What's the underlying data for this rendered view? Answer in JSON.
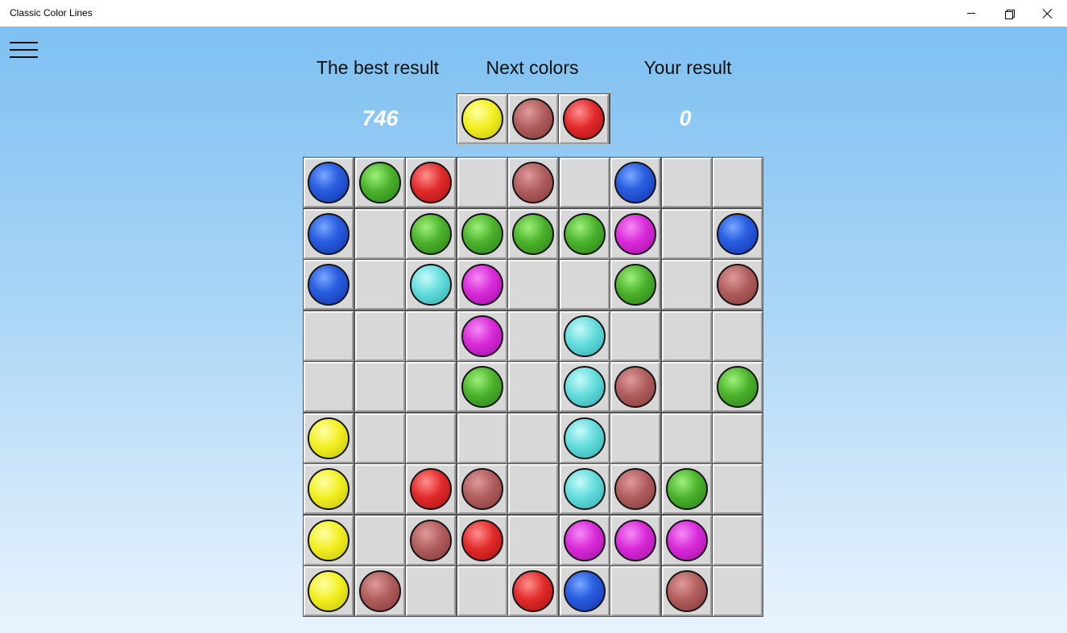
{
  "window": {
    "title": "Classic Color Lines"
  },
  "menu": {
    "icon": "hamburger-menu-icon"
  },
  "labels": {
    "best": "The best result",
    "next": "Next colors",
    "yours": "Your result"
  },
  "scores": {
    "best": "746",
    "yours": "0"
  },
  "next_colors": [
    "yellow",
    "brown",
    "red"
  ],
  "colors": {
    "blue": "#2a5fe0",
    "green": "#4bb22c",
    "red": "#e12a2a",
    "brown": "#b05d5d",
    "magenta": "#d829d8",
    "cyan": "#64dcdc",
    "yellow": "#f2ef22",
    "cell": "#d8d8d8",
    "grid_line": "#545454"
  },
  "board": [
    [
      "blue",
      "green",
      "red",
      null,
      "brown",
      null,
      "blue",
      null,
      null
    ],
    [
      "blue",
      null,
      "green",
      "green",
      "green",
      "green",
      "magenta",
      null,
      "blue"
    ],
    [
      "blue",
      null,
      "cyan",
      "magenta",
      null,
      null,
      "green",
      null,
      "brown"
    ],
    [
      null,
      null,
      null,
      "magenta",
      null,
      "cyan",
      null,
      null,
      null
    ],
    [
      null,
      null,
      null,
      "green",
      null,
      "cyan",
      "brown",
      null,
      "green"
    ],
    [
      "yellow",
      null,
      null,
      null,
      null,
      "cyan",
      null,
      null,
      null
    ],
    [
      "yellow",
      null,
      "red",
      "brown",
      null,
      "cyan",
      "brown",
      "green",
      null
    ],
    [
      "yellow",
      null,
      "brown",
      "red",
      null,
      "magenta",
      "magenta",
      "magenta",
      null
    ],
    [
      "yellow",
      "brown",
      null,
      null,
      "red",
      "blue",
      null,
      "brown",
      null
    ]
  ]
}
